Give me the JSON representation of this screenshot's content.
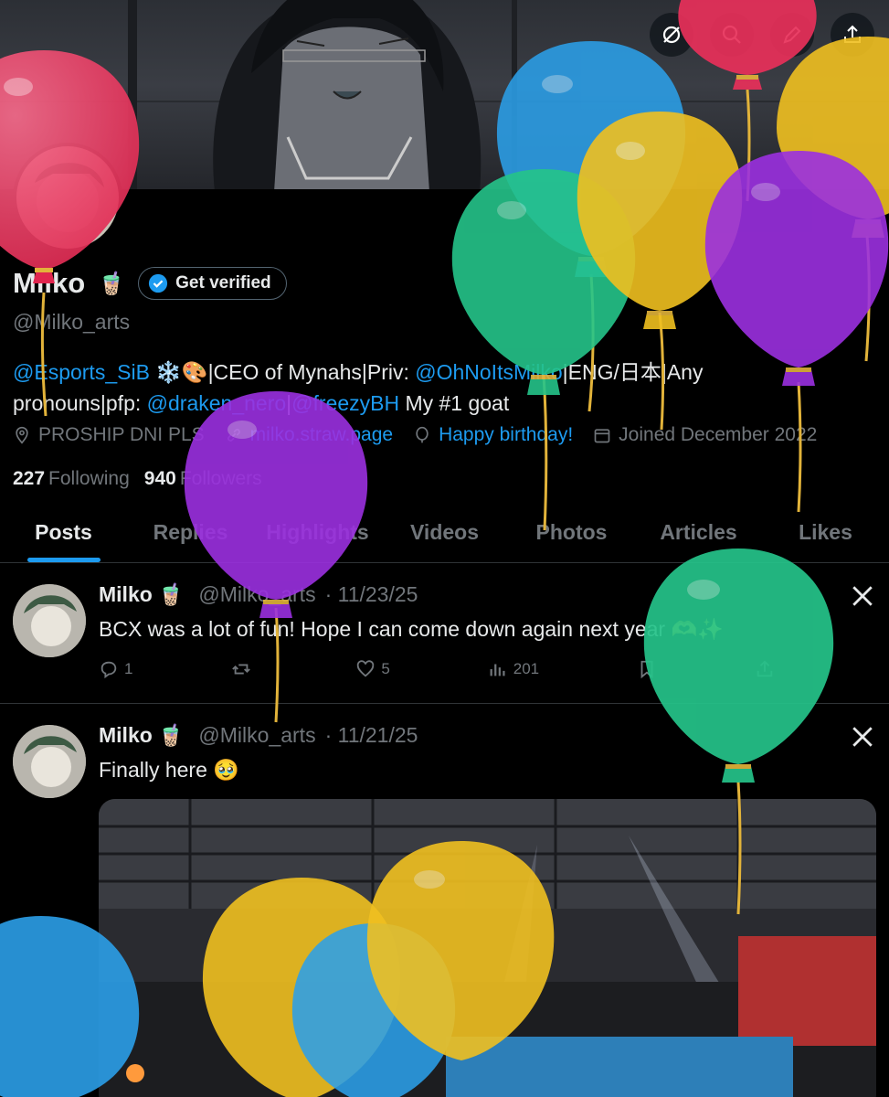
{
  "profile": {
    "display_name": "Milko",
    "name_emoji": "🧋",
    "verify_label": "Get verified",
    "handle": "@Milko_arts",
    "bio": {
      "m1": "@Esports_SiB",
      "t1": " ❄️🎨|CEO of Mynahs|Priv: ",
      "m2": "@OhNoItsMilko",
      "t2": "|ENG/日本|Any",
      "t3": "pronouns|pfp: ",
      "m3": "@draken_nero",
      "t4": "|",
      "m4": "@freezyBH",
      "t5": " My #1 goat"
    },
    "location": "PROSHIP DNI PLS",
    "website": "milko.straw.page",
    "birthday": "Happy birthday!",
    "joined": "Joined December 2022",
    "following_count": "227",
    "following_label": "Following",
    "followers_count": "940",
    "followers_label": "Followers"
  },
  "tabs": [
    "Posts",
    "Replies",
    "Highlights",
    "Videos",
    "Photos",
    "Articles",
    "Likes"
  ],
  "posts": [
    {
      "name": "Milko",
      "emoji": "🧋",
      "handle": "@Milko_arts",
      "date": "· 11/23/25",
      "text": "BCX was a lot of fun! Hope I can come down again next year 🫶✨",
      "replies": "1",
      "reposts": "",
      "likes": "5",
      "views": "201"
    },
    {
      "name": "Milko",
      "emoji": "🧋",
      "handle": "@Milko_arts",
      "date": "· 11/21/25",
      "text": "Finally here 🥹"
    }
  ],
  "icons": {
    "top": [
      "no-sync-icon",
      "search-icon",
      "edit-icon",
      "share-icon"
    ],
    "x_logo": "x-logo-icon"
  },
  "colors": {
    "accent": "#1d9bf0",
    "secondary_text": "#71767b",
    "divider": "#2f3336"
  }
}
